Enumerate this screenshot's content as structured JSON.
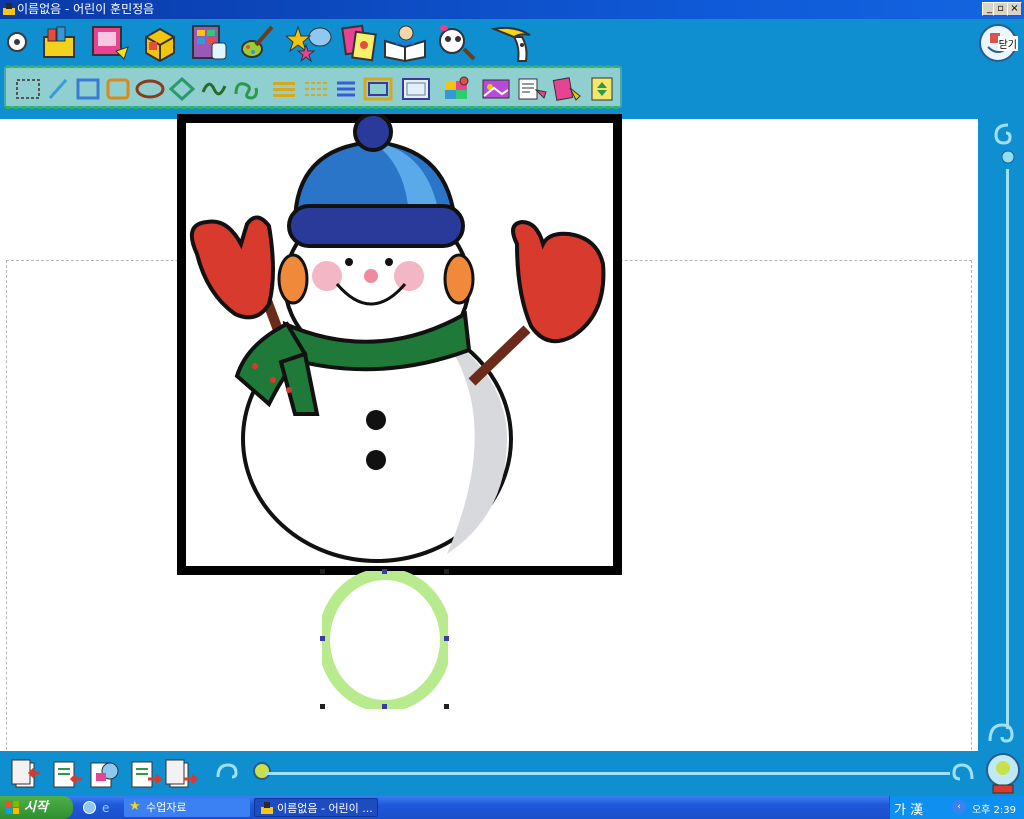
{
  "window": {
    "title": "이름없음 - 어린이 훈민정음",
    "controls": [
      "minimize",
      "restore",
      "close"
    ]
  },
  "toolbar": {
    "main_icons": [
      "disc-icon",
      "folder-books-icon",
      "picture-icon",
      "box-icon",
      "chart-icon",
      "paint-icon",
      "stars-icon",
      "cards-icon",
      "book-icon",
      "magnify-icon",
      "banana-icon"
    ],
    "exit_label": "닫기",
    "draw_tools": [
      "select-rect-tool",
      "line-tool",
      "rect-tool",
      "rounded-rect-tool",
      "ellipse-tool",
      "diamond-tool",
      "curve-tool",
      "spiral-tool",
      "line-thick-tool",
      "line-dash-tool",
      "line-style-tool",
      "frame-tool",
      "frame-plain-tool",
      "fill-color-tool",
      "image-tool",
      "text-tool",
      "text-effect-tool",
      "sort-tool"
    ]
  },
  "canvas": {
    "objects": [
      "snowman-image",
      "circle-shape"
    ]
  },
  "bottom_nav": {
    "buttons": [
      "first-page",
      "prev-page",
      "page-list",
      "next-page",
      "last-page"
    ]
  },
  "taskbar": {
    "start_label": "시작",
    "tasks": [
      "수업자료",
      "이름없음 - 어린이 ..."
    ],
    "ime": "가 漢",
    "clock": "오후 2:39"
  },
  "colors": {
    "window_blue": "#0f8fcf",
    "toolbar_bg": "#8fcfcf",
    "ring": "#b8ea8e",
    "taskbar": "#1f58d8"
  }
}
